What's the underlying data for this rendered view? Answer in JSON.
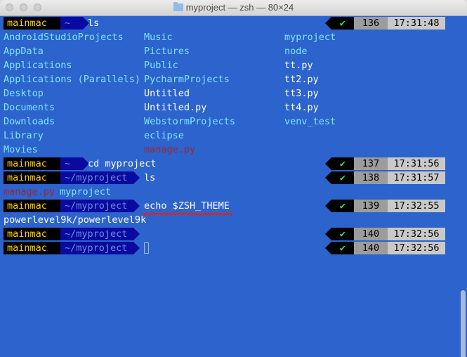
{
  "window": {
    "title": "myproject — zsh — 80×24",
    "accent": "#2c63cc"
  },
  "prompts": [
    {
      "user": "mainmac",
      "dir": "~",
      "cmd": "ls",
      "num": "136",
      "time": "17:31:48"
    },
    {
      "user": "mainmac",
      "dir": "~",
      "cmd": "cd myproject",
      "num": "137",
      "time": "17:31:56"
    },
    {
      "user": "mainmac",
      "dir": "~/myproject",
      "cmd": "ls",
      "num": "138",
      "time": "17:31:57"
    },
    {
      "user": "mainmac",
      "dir": "~/myproject",
      "cmd": "echo $ZSH_THEME",
      "num": "139",
      "time": "17:32:55"
    },
    {
      "user": "mainmac",
      "dir": "~/myproject",
      "cmd": "",
      "num": "140",
      "time": "17:32:56"
    },
    {
      "user": "mainmac",
      "dir": "~/myproject",
      "cmd": "",
      "num": "140",
      "time": "17:32:56"
    }
  ],
  "status_icon": "checkmark-icon",
  "status_mark": "✔",
  "ls_output": {
    "col1": [
      "AndroidStudioProjects",
      "AppData",
      "Applications",
      "Applications (Parallels)",
      "Desktop",
      "Documents",
      "Downloads",
      "Library",
      "Movies"
    ],
    "col2": [
      "Music",
      "Pictures",
      "Public",
      "PycharmProjects",
      "Untitled",
      "Untitled.py",
      "WebstormProjects",
      "eclipse",
      "manage.py"
    ],
    "col3": [
      "myproject",
      "node",
      "tt.py",
      "tt2.py",
      "tt3.py",
      "tt4.py",
      "venv_test"
    ]
  },
  "ls2_output": {
    "file": "manage.py",
    "folder": "myproject"
  },
  "echo_output": "powerlevel9k/powerlevel9k"
}
